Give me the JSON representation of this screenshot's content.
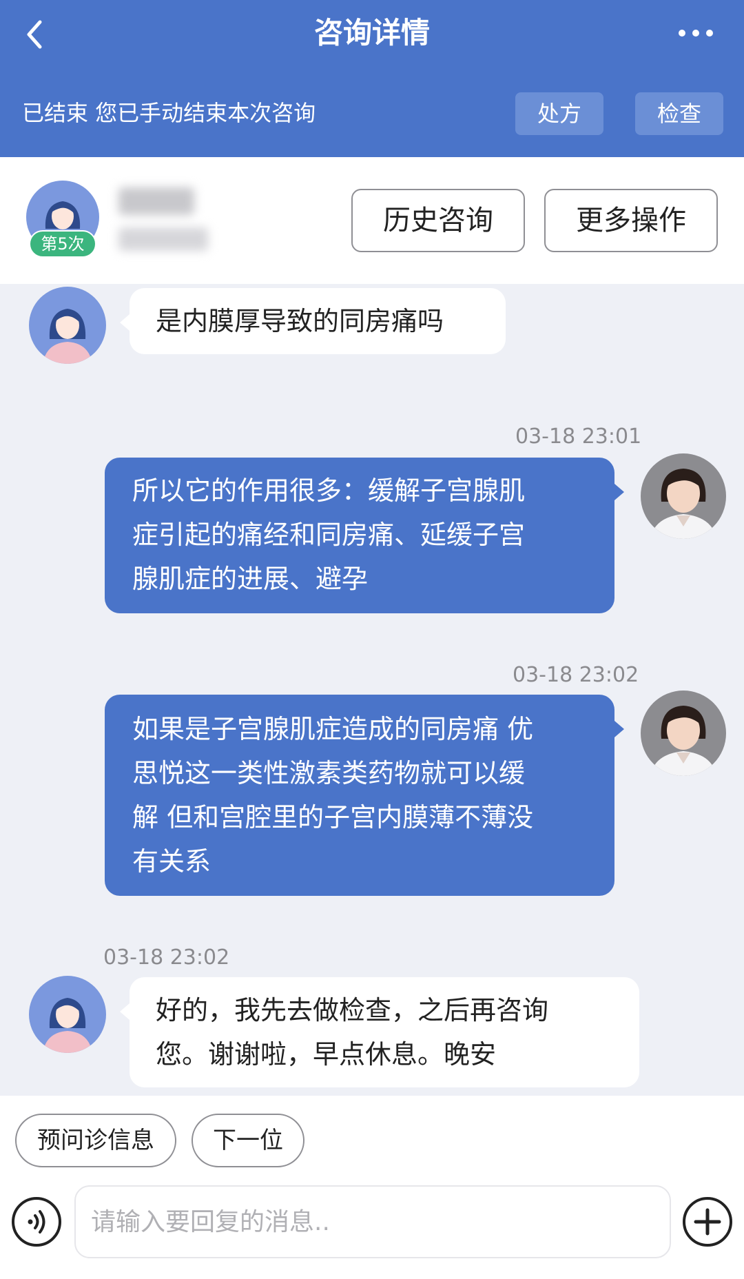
{
  "header": {
    "title": "咨询详情",
    "status_text": "已结束 您已手动结束本次咨询",
    "prescription_label": "处方",
    "exam_label": "检查",
    "accent_color": "#4a74c9"
  },
  "patient": {
    "visit_badge": "第5次",
    "history_button": "历史咨询",
    "more_actions_button": "更多操作"
  },
  "messages": [
    {
      "sender": "patient",
      "text": "是内膜厚导致的同房痛吗"
    },
    {
      "sender": "doctor",
      "time": "03-18 23:01",
      "lines": [
        "所以它的作用很多：缓解子宫腺肌",
        "症引起的痛经和同房痛、延缓子宫",
        "腺肌症的进展、避孕"
      ]
    },
    {
      "sender": "doctor",
      "time": "03-18 23:02",
      "lines": [
        "如果是子宫腺肌症造成的同房痛 优",
        "思悦这一类性激素类药物就可以缓",
        "解 但和宫腔里的子宫内膜薄不薄没",
        "有关系"
      ]
    },
    {
      "sender": "patient",
      "time": "03-18 23:02",
      "lines": [
        "好的，我先去做检查，之后再咨询",
        "您。谢谢啦，早点休息。晚安"
      ]
    }
  ],
  "footer": {
    "pre_consult_button": "预问诊信息",
    "next_button": "下一位",
    "input_placeholder": "请输入要回复的消息.."
  },
  "icons": {
    "back": "chevron-left-icon",
    "more": "ellipsis-icon",
    "voice": "voice-icon",
    "add": "plus-circle-icon"
  }
}
